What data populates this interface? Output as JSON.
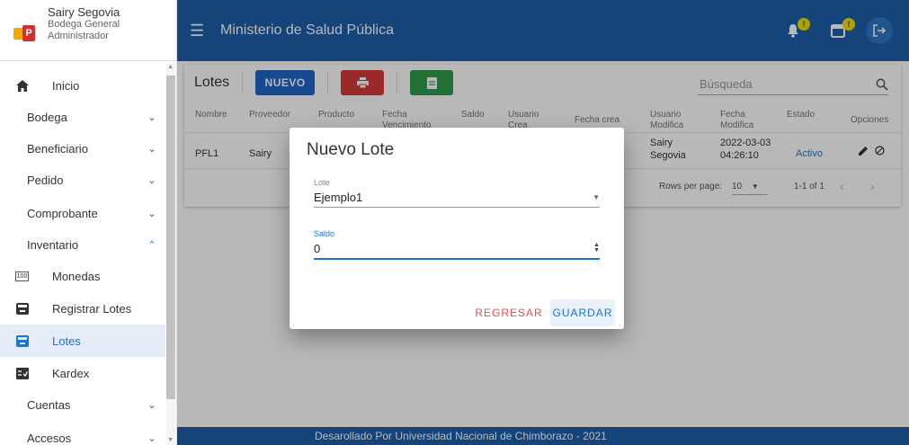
{
  "user": {
    "name": "Sairy Segovia",
    "location": "Bodega General",
    "role": "Administrador"
  },
  "sidebar": {
    "items": [
      {
        "label": "Inicio",
        "icon": "home-icon",
        "type": "icon"
      },
      {
        "label": "Bodega",
        "type": "group",
        "expanded": false
      },
      {
        "label": "Beneficiario",
        "type": "group",
        "expanded": false
      },
      {
        "label": "Pedido",
        "type": "group",
        "expanded": false
      },
      {
        "label": "Comprobante",
        "type": "group",
        "expanded": false
      },
      {
        "label": "Inventario",
        "type": "group",
        "expanded": true
      },
      {
        "label": "Monedas",
        "icon": "coins-icon",
        "icon_text": "100",
        "type": "icon"
      },
      {
        "label": "Registrar Lotes",
        "icon": "inbox-icon",
        "type": "icon"
      },
      {
        "label": "Lotes",
        "icon": "inbox-icon",
        "type": "icon",
        "active": true
      },
      {
        "label": "Kardex",
        "icon": "checklist-icon",
        "type": "icon"
      },
      {
        "label": "Cuentas",
        "type": "group",
        "expanded": false
      },
      {
        "label": "Accesos",
        "type": "group",
        "expanded": false
      }
    ]
  },
  "topbar": {
    "title": "Ministerio de Salud Pública",
    "bell_badge": "!",
    "calendar_badge": "!"
  },
  "page": {
    "title": "Lotes",
    "new_label": "NUEVO",
    "search_placeholder": "Búsqueda",
    "columns": {
      "nombre": "Nombre",
      "proveedor": "Proveedor",
      "producto": "Producto",
      "fecha_venc_1": "Fecha",
      "fecha_venc_2": "Vencimiento",
      "saldo": "Saldo",
      "usuario_crea_1": "Usuario",
      "usuario_crea_2": "Crea",
      "fecha_crea": "Fecha crea",
      "usuario_mod_1": "Usuario",
      "usuario_mod_2": "Modifica",
      "fecha_mod_1": "Fecha",
      "fecha_mod_2": "Modifica",
      "estado": "Estado",
      "opciones": "Opciones"
    },
    "row": {
      "nombre": "PFL1",
      "proveedor": "Sairy",
      "usuario_mod_1": "Sairy",
      "usuario_mod_2": "Segovia",
      "fecha_mod_1": "2022-03-03",
      "fecha_mod_2": "04:26:10",
      "estado": "Activo"
    },
    "pager": {
      "rows_label": "Rows per page:",
      "rows_value": "10",
      "range": "1-1 of 1"
    }
  },
  "dialog": {
    "title": "Nuevo Lote",
    "lote_label": "Lote",
    "lote_value": "Ejemplo1",
    "saldo_label": "Saldo",
    "saldo_value": "0",
    "cancel_label": "REGRESAR",
    "save_label": "GUARDAR"
  },
  "footer": {
    "text": "Desarollado Por Universidad Nacional de Chimborazo - 2021"
  },
  "colors": {
    "primary": "#1d5fa8",
    "new_button": "#1e66c9",
    "print_button": "#d63a3a",
    "export_button": "#2e9b4a",
    "active_status": "#1976d2"
  }
}
